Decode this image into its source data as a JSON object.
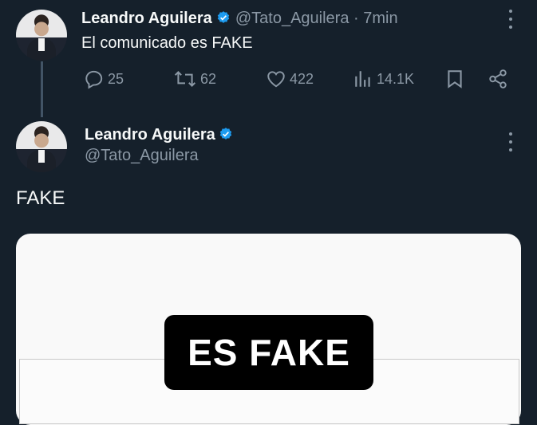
{
  "tweet1": {
    "name": "Leandro Aguilera",
    "handle": "@Tato_Aguilera",
    "time": "· 7min",
    "text": "El comunicado es FAKE",
    "actions": {
      "replies": "25",
      "retweets": "62",
      "likes": "422",
      "views": "14.1K"
    }
  },
  "tweet2": {
    "name": "Leandro Aguilera",
    "handle": "@Tato_Aguilera",
    "text": "FAKE",
    "image_banner": "ES FAKE"
  },
  "colors": {
    "background": "#15202b",
    "verified": "#1d9bf0",
    "muted": "#8b98a5"
  },
  "icons": [
    "verified-badge-icon",
    "more-options-icon",
    "reply-icon",
    "retweet-icon",
    "like-icon",
    "views-icon",
    "bookmark-icon",
    "share-icon"
  ]
}
